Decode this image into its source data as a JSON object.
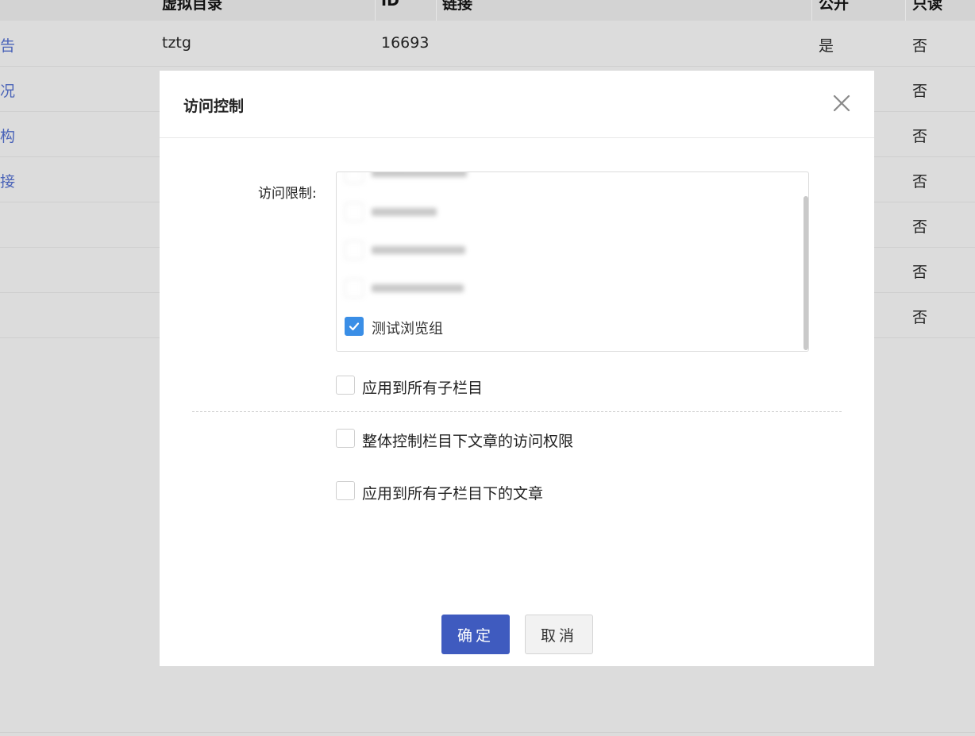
{
  "table": {
    "headers": [
      "虚拟目录",
      "ID",
      "链接",
      "公开",
      "只读"
    ],
    "rows": [
      {
        "name": "告",
        "dir": "tztg",
        "id": "16693",
        "public": "是",
        "readonly": "否"
      },
      {
        "name": "况",
        "dir": "",
        "id": "",
        "public": "",
        "readonly": "否"
      },
      {
        "name": "构",
        "dir": "",
        "id": "",
        "public": "",
        "readonly": "否"
      },
      {
        "name": "接",
        "dir": "",
        "id": "",
        "public": "",
        "readonly": "否"
      },
      {
        "name": "",
        "dir": "",
        "id": "",
        "public": "",
        "readonly": "否"
      },
      {
        "name": "",
        "dir": "",
        "id": "",
        "public": "",
        "readonly": "否"
      },
      {
        "name": "",
        "dir": "",
        "id": "",
        "public": "",
        "readonly": "否"
      }
    ]
  },
  "modal": {
    "title": "访问控制",
    "field_label": "访问限制:",
    "groups": [
      {
        "label": "测试浏览组",
        "checked": true
      }
    ],
    "options": [
      {
        "label": "应用到所有子栏目",
        "checked": false
      },
      {
        "label": "整体控制栏目下文章的访问权限",
        "checked": false
      },
      {
        "label": "应用到所有子栏目下的文章",
        "checked": false
      }
    ],
    "ok_label": "确定",
    "cancel_label": "取消"
  },
  "colors": {
    "primary": "#3f5bbf",
    "checkbox_checked": "#3a8ee6",
    "link": "#4a63b8"
  }
}
